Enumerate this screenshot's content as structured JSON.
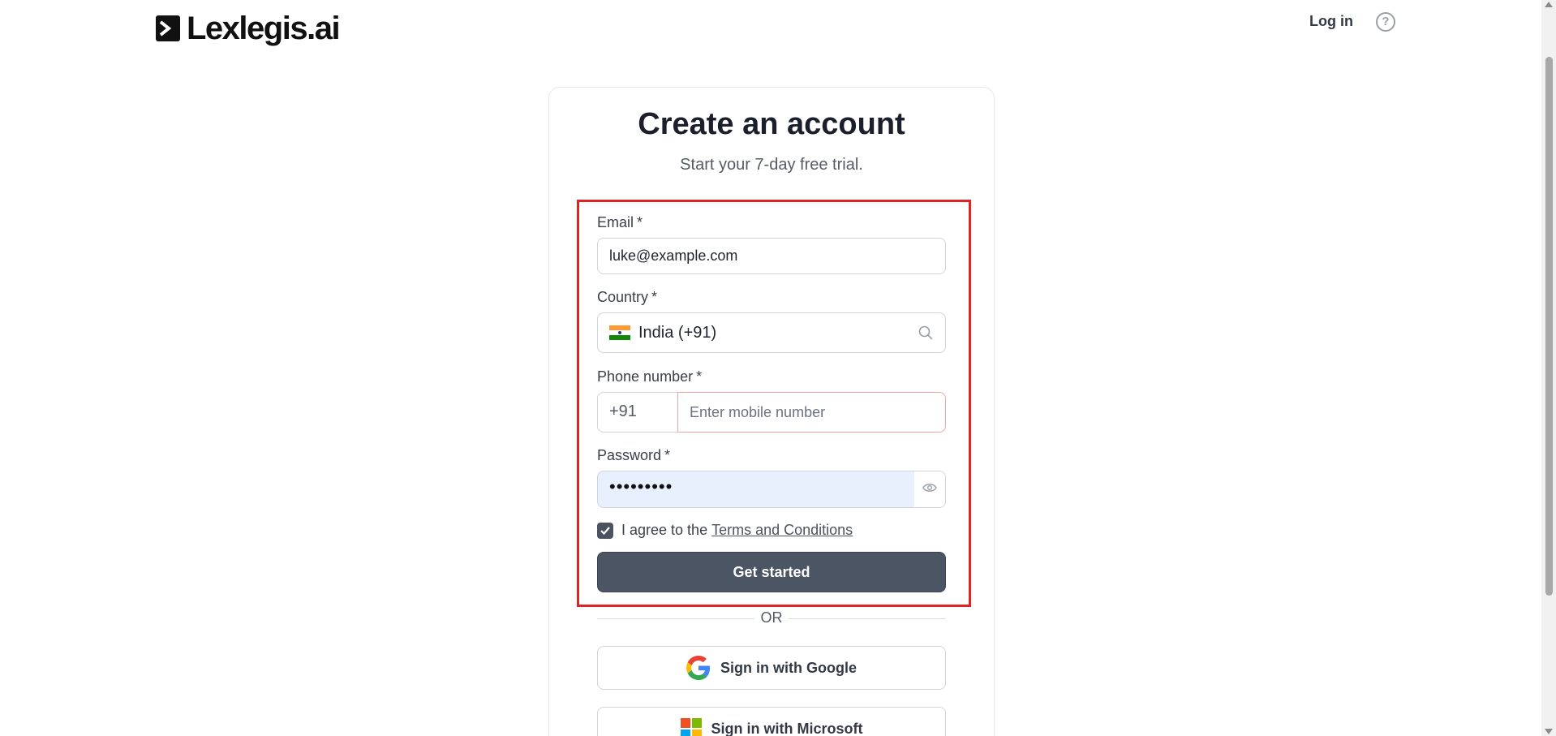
{
  "header": {
    "logo_text": "Lexlegis.ai",
    "login_label": "Log in",
    "help_symbol": "?"
  },
  "card": {
    "title": "Create an account",
    "subtitle": "Start your 7-day free trial."
  },
  "form": {
    "email": {
      "label": "Email",
      "required_mark": "*",
      "value": "luke@example.com"
    },
    "country": {
      "label": "Country",
      "required_mark": "*",
      "value": "India (+91)",
      "flag_icon": "india-flag-icon"
    },
    "phone": {
      "label": "Phone number",
      "required_mark": "*",
      "prefix": "+91",
      "placeholder": "Enter mobile number"
    },
    "password": {
      "label": "Password",
      "required_mark": "*",
      "masked_value": "•••••••••"
    },
    "agree": {
      "text": "I agree to the",
      "link": "Terms and Conditions",
      "checked": true
    },
    "submit_label": "Get started"
  },
  "divider_text": "OR",
  "social": {
    "google_label": "Sign in with Google",
    "microsoft_label": "Sign in with Microsoft"
  },
  "colors": {
    "primary_button": "#4b5563",
    "highlight_border": "#e02424",
    "autofill_bg": "#e8f0fe",
    "error_border": "#f2a3a3"
  }
}
